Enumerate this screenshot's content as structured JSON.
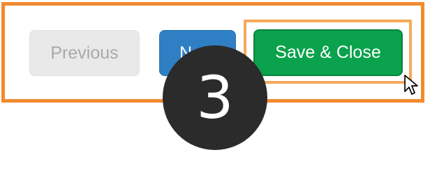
{
  "buttons": {
    "previous_label": "Previous",
    "next_label": "Next",
    "save_close_label": "Save & Close"
  },
  "step_badge": {
    "number": "3"
  },
  "colors": {
    "highlight_orange": "#f28a2e",
    "inner_highlight": "#f5a95a",
    "previous_bg": "#e9e9e9",
    "previous_text": "#a7aba7",
    "next_bg": "#2f7fc4",
    "save_bg": "#0aa24c",
    "badge_bg": "#2b2b2b"
  },
  "icons": {
    "cursor": "mouse-pointer-icon"
  }
}
